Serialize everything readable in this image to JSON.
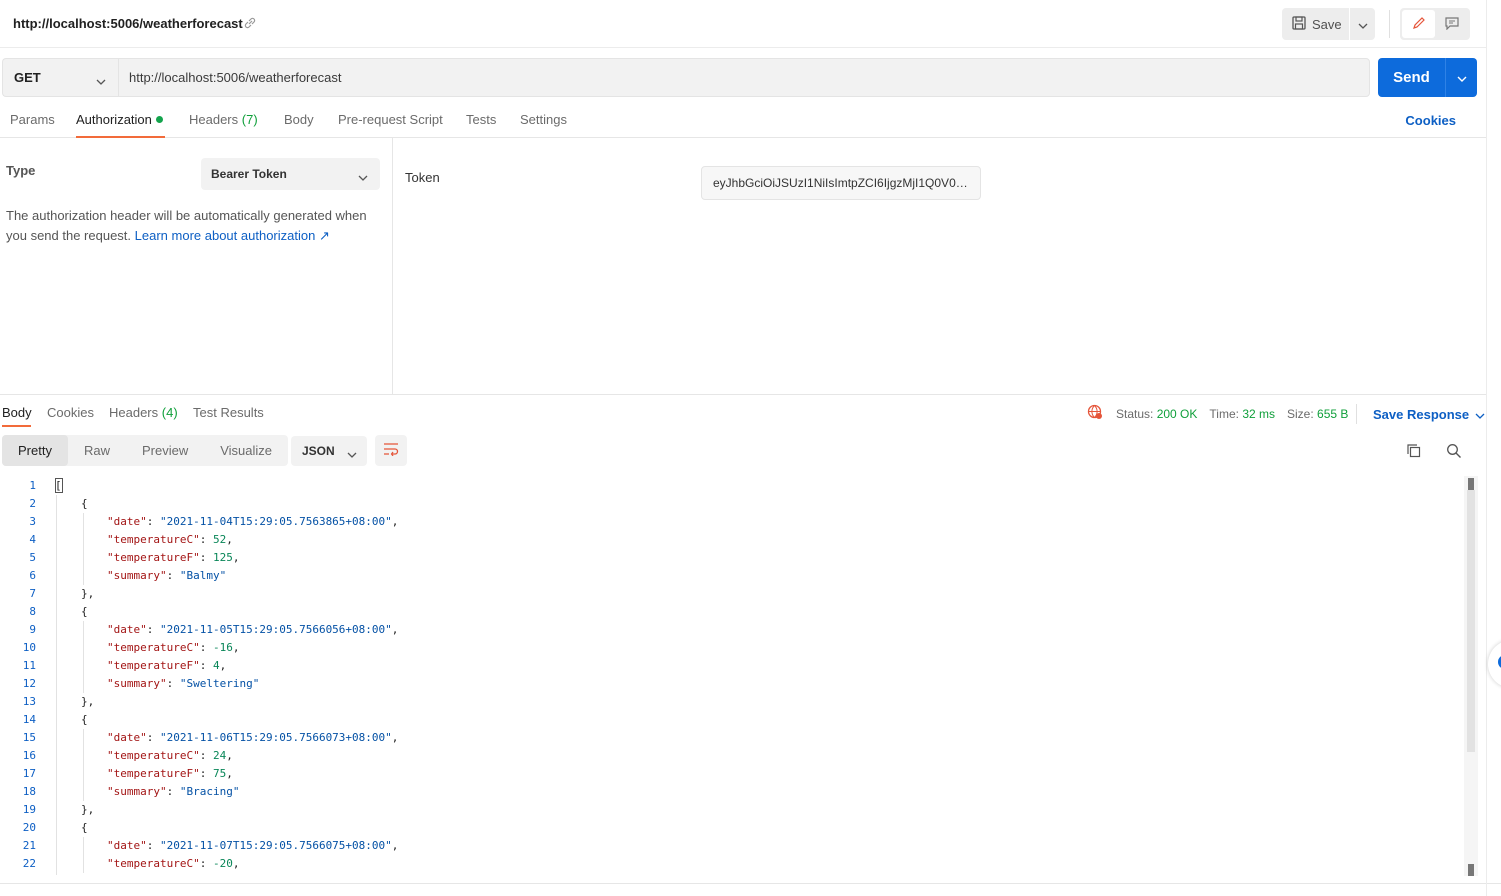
{
  "header": {
    "title": "http://localhost:5006/weatherforecast",
    "save_label": "Save"
  },
  "request": {
    "method": "GET",
    "url": "http://localhost:5006/weatherforecast",
    "send_label": "Send"
  },
  "req_tabs": {
    "params": "Params",
    "authorization": "Authorization",
    "headers": "Headers",
    "headers_count": "(7)",
    "body": "Body",
    "prerequest": "Pre-request Script",
    "tests": "Tests",
    "settings": "Settings",
    "cookies": "Cookies"
  },
  "auth": {
    "type_label": "Type",
    "type_value": "Bearer Token",
    "description": "The authorization header will be automatically generated when you send the request.",
    "learn_more": "Learn more about authorization ↗",
    "token_label": "Token",
    "token_value": "eyJhbGciOiJSUzI1NiIsImtpZCI6IjgzMjI1Q0V0…"
  },
  "resp_tabs": {
    "body": "Body",
    "cookies": "Cookies",
    "headers": "Headers",
    "headers_count": "(4)",
    "test_results": "Test Results"
  },
  "status": {
    "status_label": "Status:",
    "status_value": "200 OK",
    "time_label": "Time:",
    "time_value": "32 ms",
    "size_label": "Size:",
    "size_value": "655 B",
    "save_response": "Save Response"
  },
  "view": {
    "pretty": "Pretty",
    "raw": "Raw",
    "preview": "Preview",
    "visualize": "Visualize",
    "format": "JSON"
  },
  "code_lines": [
    {
      "n": "1",
      "indent": 0,
      "parts": [
        [
          "p",
          "["
        ]
      ]
    },
    {
      "n": "2",
      "indent": 1,
      "parts": [
        [
          "p",
          "{"
        ]
      ]
    },
    {
      "n": "3",
      "indent": 2,
      "parts": [
        [
          "k",
          "\"date\""
        ],
        [
          "p",
          ": "
        ],
        [
          "s",
          "\"2021-11-04T15:29:05.7563865+08:00\""
        ],
        [
          "p",
          ","
        ]
      ]
    },
    {
      "n": "4",
      "indent": 2,
      "parts": [
        [
          "k",
          "\"temperatureC\""
        ],
        [
          "p",
          ": "
        ],
        [
          "n",
          "52"
        ],
        [
          "p",
          ","
        ]
      ]
    },
    {
      "n": "5",
      "indent": 2,
      "parts": [
        [
          "k",
          "\"temperatureF\""
        ],
        [
          "p",
          ": "
        ],
        [
          "n",
          "125"
        ],
        [
          "p",
          ","
        ]
      ]
    },
    {
      "n": "6",
      "indent": 2,
      "parts": [
        [
          "k",
          "\"summary\""
        ],
        [
          "p",
          ": "
        ],
        [
          "s",
          "\"Balmy\""
        ]
      ]
    },
    {
      "n": "7",
      "indent": 1,
      "parts": [
        [
          "p",
          "},"
        ]
      ]
    },
    {
      "n": "8",
      "indent": 1,
      "parts": [
        [
          "p",
          "{"
        ]
      ]
    },
    {
      "n": "9",
      "indent": 2,
      "parts": [
        [
          "k",
          "\"date\""
        ],
        [
          "p",
          ": "
        ],
        [
          "s",
          "\"2021-11-05T15:29:05.7566056+08:00\""
        ],
        [
          "p",
          ","
        ]
      ]
    },
    {
      "n": "10",
      "indent": 2,
      "parts": [
        [
          "k",
          "\"temperatureC\""
        ],
        [
          "p",
          ": "
        ],
        [
          "n",
          "-16"
        ],
        [
          "p",
          ","
        ]
      ]
    },
    {
      "n": "11",
      "indent": 2,
      "parts": [
        [
          "k",
          "\"temperatureF\""
        ],
        [
          "p",
          ": "
        ],
        [
          "n",
          "4"
        ],
        [
          "p",
          ","
        ]
      ]
    },
    {
      "n": "12",
      "indent": 2,
      "parts": [
        [
          "k",
          "\"summary\""
        ],
        [
          "p",
          ": "
        ],
        [
          "s",
          "\"Sweltering\""
        ]
      ]
    },
    {
      "n": "13",
      "indent": 1,
      "parts": [
        [
          "p",
          "},"
        ]
      ]
    },
    {
      "n": "14",
      "indent": 1,
      "parts": [
        [
          "p",
          "{"
        ]
      ]
    },
    {
      "n": "15",
      "indent": 2,
      "parts": [
        [
          "k",
          "\"date\""
        ],
        [
          "p",
          ": "
        ],
        [
          "s",
          "\"2021-11-06T15:29:05.7566073+08:00\""
        ],
        [
          "p",
          ","
        ]
      ]
    },
    {
      "n": "16",
      "indent": 2,
      "parts": [
        [
          "k",
          "\"temperatureC\""
        ],
        [
          "p",
          ": "
        ],
        [
          "n",
          "24"
        ],
        [
          "p",
          ","
        ]
      ]
    },
    {
      "n": "17",
      "indent": 2,
      "parts": [
        [
          "k",
          "\"temperatureF\""
        ],
        [
          "p",
          ": "
        ],
        [
          "n",
          "75"
        ],
        [
          "p",
          ","
        ]
      ]
    },
    {
      "n": "18",
      "indent": 2,
      "parts": [
        [
          "k",
          "\"summary\""
        ],
        [
          "p",
          ": "
        ],
        [
          "s",
          "\"Bracing\""
        ]
      ]
    },
    {
      "n": "19",
      "indent": 1,
      "parts": [
        [
          "p",
          "},"
        ]
      ]
    },
    {
      "n": "20",
      "indent": 1,
      "parts": [
        [
          "p",
          "{"
        ]
      ]
    },
    {
      "n": "21",
      "indent": 2,
      "parts": [
        [
          "k",
          "\"date\""
        ],
        [
          "p",
          ": "
        ],
        [
          "s",
          "\"2021-11-07T15:29:05.7566075+08:00\""
        ],
        [
          "p",
          ","
        ]
      ]
    },
    {
      "n": "22",
      "indent": 2,
      "parts": [
        [
          "k",
          "\"temperatureC\""
        ],
        [
          "p",
          ": "
        ],
        [
          "n",
          "-20"
        ],
        [
          "p",
          ","
        ]
      ]
    }
  ],
  "colors": {
    "accent": "#0d6bdc",
    "tab_underline": "#f26b3a",
    "status_ok": "#0f9f3a",
    "json_key": "#a31515",
    "json_string": "#0451a5",
    "json_number": "#098658"
  },
  "icons": [
    "link-icon",
    "save-icon",
    "chevron-down-icon",
    "edit-icon",
    "comment-icon",
    "globe-error-icon",
    "wrap-lines-icon",
    "copy-icon",
    "search-icon"
  ]
}
